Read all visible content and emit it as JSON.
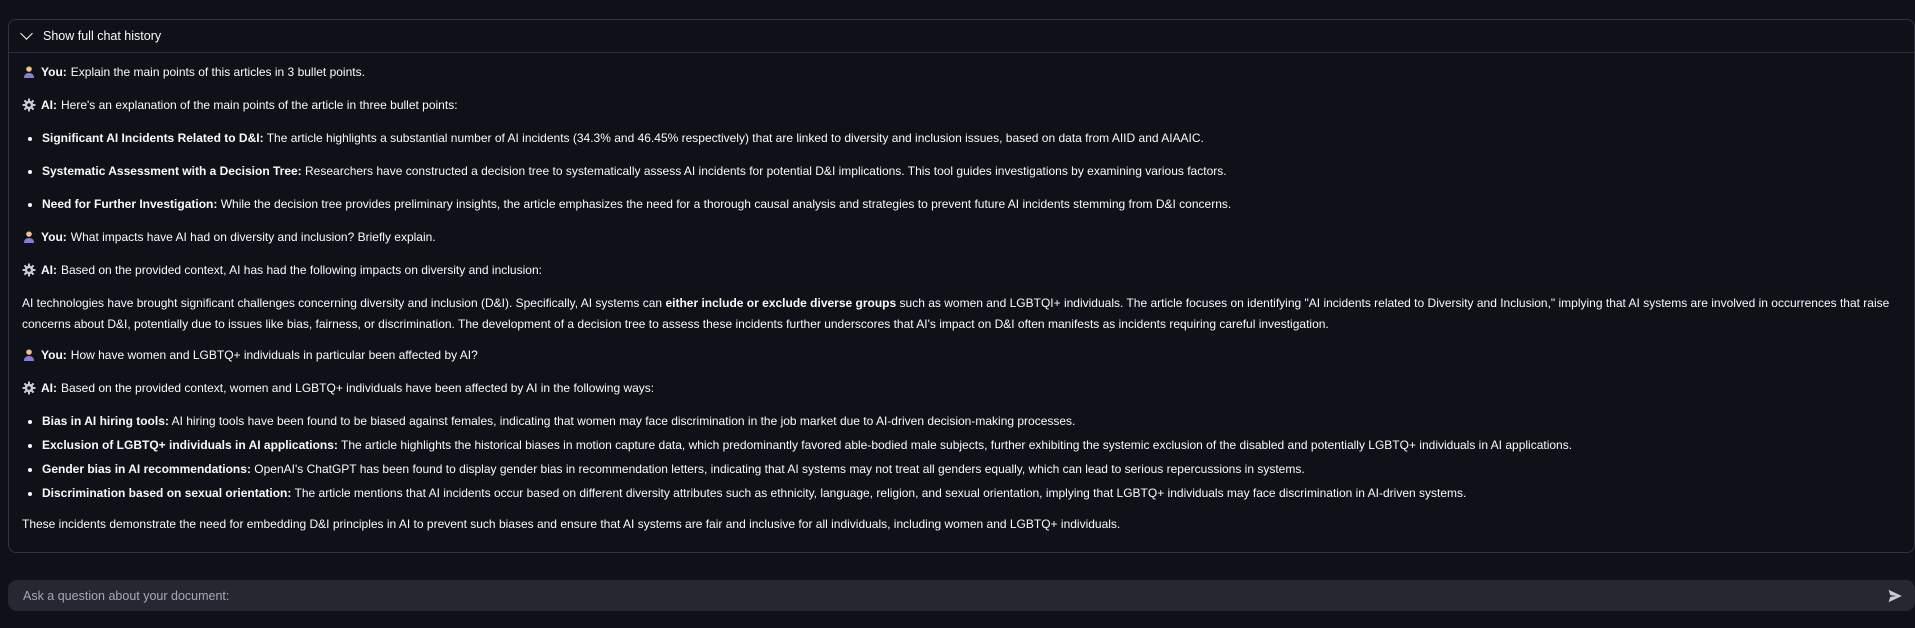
{
  "expander": {
    "label": "Show full chat history",
    "icon": "chevron-down-icon"
  },
  "chat": {
    "user_prefix": "You:",
    "ai_prefix": "AI:",
    "user_avatar_icon": "person-avatar-icon",
    "ai_avatar_icon": "gear-icon",
    "q1": "Explain the main points of this articles in 3 bullet points.",
    "a1_intro": "Here's an explanation of the main points of the article in three bullet points:",
    "a1_bullets": [
      {
        "title": "Significant AI Incidents Related to D&I:",
        "text": "The article highlights a substantial number of AI incidents (34.3% and 46.45% respectively) that are linked to diversity and inclusion issues, based on data from AIID and AIAAIC."
      },
      {
        "title": "Systematic Assessment with a Decision Tree:",
        "text": "Researchers have constructed a decision tree to systematically assess AI incidents for potential D&I implications. This tool guides investigations by examining various factors."
      },
      {
        "title": "Need for Further Investigation:",
        "text": "While the decision tree provides preliminary insights, the article emphasizes the need for a thorough causal analysis and strategies to prevent future AI incidents stemming from D&I concerns."
      }
    ],
    "q2": "What impacts have AI had on diversity and inclusion? Briefly explain.",
    "a2_intro": "Based on the provided context, AI has had the following impacts on diversity and inclusion:",
    "a2_para_before": "AI technologies have brought significant challenges concerning diversity and inclusion (D&I). Specifically, AI systems can ",
    "a2_para_bold": "either include or exclude diverse groups",
    "a2_para_after": " such as women and LGBTQI+ individuals. The article focuses on identifying \"AI incidents related to Diversity and Inclusion,\" implying that AI systems are involved in occurrences that raise concerns about D&I, potentially due to issues like bias, fairness, or discrimination. The development of a decision tree to assess these incidents further underscores that AI's impact on D&I often manifests as incidents requiring careful investigation.",
    "q3": "How have women and LGBTQ+ individuals in particular been affected by AI?",
    "a3_intro": "Based on the provided context, women and LGBTQ+ individuals have been affected by AI in the following ways:",
    "a3_bullets": [
      {
        "title": "Bias in AI hiring tools:",
        "text": "AI hiring tools have been found to be biased against females, indicating that women may face discrimination in the job market due to AI-driven decision-making processes."
      },
      {
        "title": "Exclusion of LGBTQ+ individuals in AI applications:",
        "text": "The article highlights the historical biases in motion capture data, which predominantly favored able-bodied male subjects, further exhibiting the systemic exclusion of the disabled and potentially LGBTQ+ individuals in AI applications."
      },
      {
        "title": "Gender bias in AI recommendations:",
        "text": "OpenAI's ChatGPT has been found to display gender bias in recommendation letters, indicating that AI systems may not treat all genders equally, which can lead to serious repercussions in systems."
      },
      {
        "title": "Discrimination based on sexual orientation:",
        "text": "The article mentions that AI incidents occur based on different diversity attributes such as ethnicity, language, religion, and sexual orientation, implying that LGBTQ+ individuals may face discrimination in AI-driven systems."
      }
    ],
    "a3_conclusion": "These incidents demonstrate the need for embedding D&I principles in AI to prevent such biases and ensure that AI systems are fair and inclusive for all individuals, including women and LGBTQ+ individuals."
  },
  "input": {
    "placeholder": "Ask a question about your document:",
    "value": "",
    "send_icon": "send-icon"
  },
  "colors": {
    "background": "#0e1117",
    "border": "#31333f",
    "input_bg": "#262730",
    "text": "#fafafa",
    "placeholder": "#a3a8b8"
  }
}
